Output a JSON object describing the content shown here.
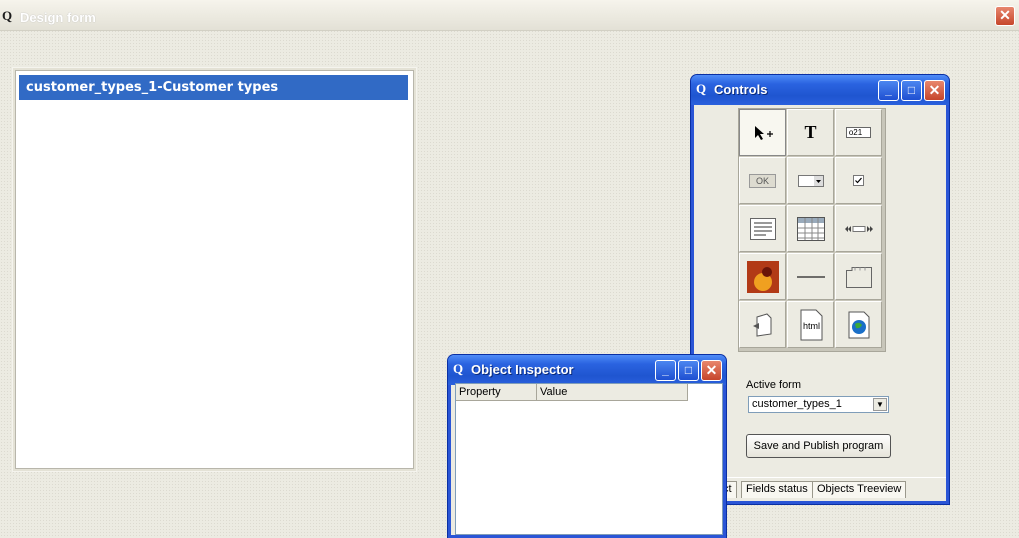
{
  "main_window": {
    "title": "Design form",
    "close_glyph": "✕"
  },
  "form_panel": {
    "selected_item": "customer_types_1-Customer types"
  },
  "controls_window": {
    "title": "Controls",
    "icon_glyph": "Q",
    "buttons": {
      "minimize": "_",
      "maximize": "□",
      "close": "✕"
    },
    "tool_labels": {
      "text": "T",
      "edit": "o21",
      "button": "OK",
      "html": "html"
    },
    "active_form_label": "Active form",
    "active_form_value": "customer_types_1",
    "save_button": "Save and Publish program",
    "tabs": [
      "ct",
      "Fields status",
      "Objects Treeview"
    ]
  },
  "inspector_window": {
    "title": "Object Inspector",
    "columns": [
      "Property",
      "Value"
    ]
  },
  "colors": {
    "accent": "#316ac5",
    "titlebar": "#2a63e0",
    "close": "#c6452b"
  }
}
